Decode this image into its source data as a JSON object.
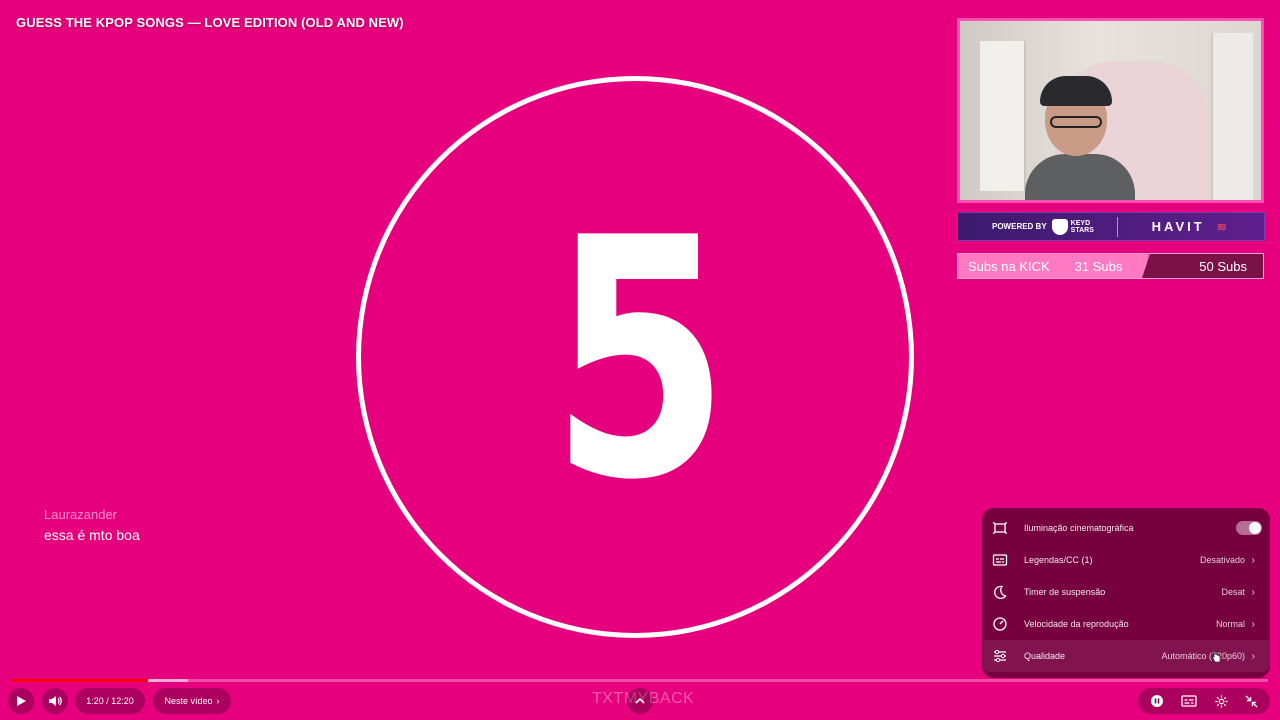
{
  "video": {
    "title": "GUESS THE KPOP SONGS — LOVE EDITION (OLD AND NEW)",
    "countdown": "5"
  },
  "overlay": {
    "sponsor": {
      "powered_by": "POWERED BY",
      "brand": "KEYD STARS",
      "partner": "HAVIT"
    },
    "subs_goal": {
      "label": "Subs na KICK",
      "current": "31 Subs",
      "goal": "50 Subs",
      "progress": 0.62
    }
  },
  "chat": {
    "username": "Laurazander",
    "message": "essa é mto boa"
  },
  "settings_menu": {
    "items": [
      {
        "icon": "cinematic-lighting-icon",
        "label": "Iluminação cinematográfica",
        "toggle": true
      },
      {
        "icon": "subtitles-icon",
        "label": "Legendas/CC (1)",
        "value": "Desativado"
      },
      {
        "icon": "sleep-timer-icon",
        "label": "Timer de suspensão",
        "value": "Desat"
      },
      {
        "icon": "playback-speed-icon",
        "label": "Velocidade da reprodução",
        "value": "Normal"
      },
      {
        "icon": "quality-sliders-icon",
        "label": "Qualidade",
        "value": "Automático (720p60)"
      }
    ]
  },
  "player": {
    "time": "1:20 / 12:20",
    "chapter": "Neste vídeo",
    "watermark": "TXTMYBACK",
    "progress": 0.108,
    "buffered": 0.14,
    "colors": {
      "progress": "#ff0000",
      "background": "#e6007e"
    }
  }
}
